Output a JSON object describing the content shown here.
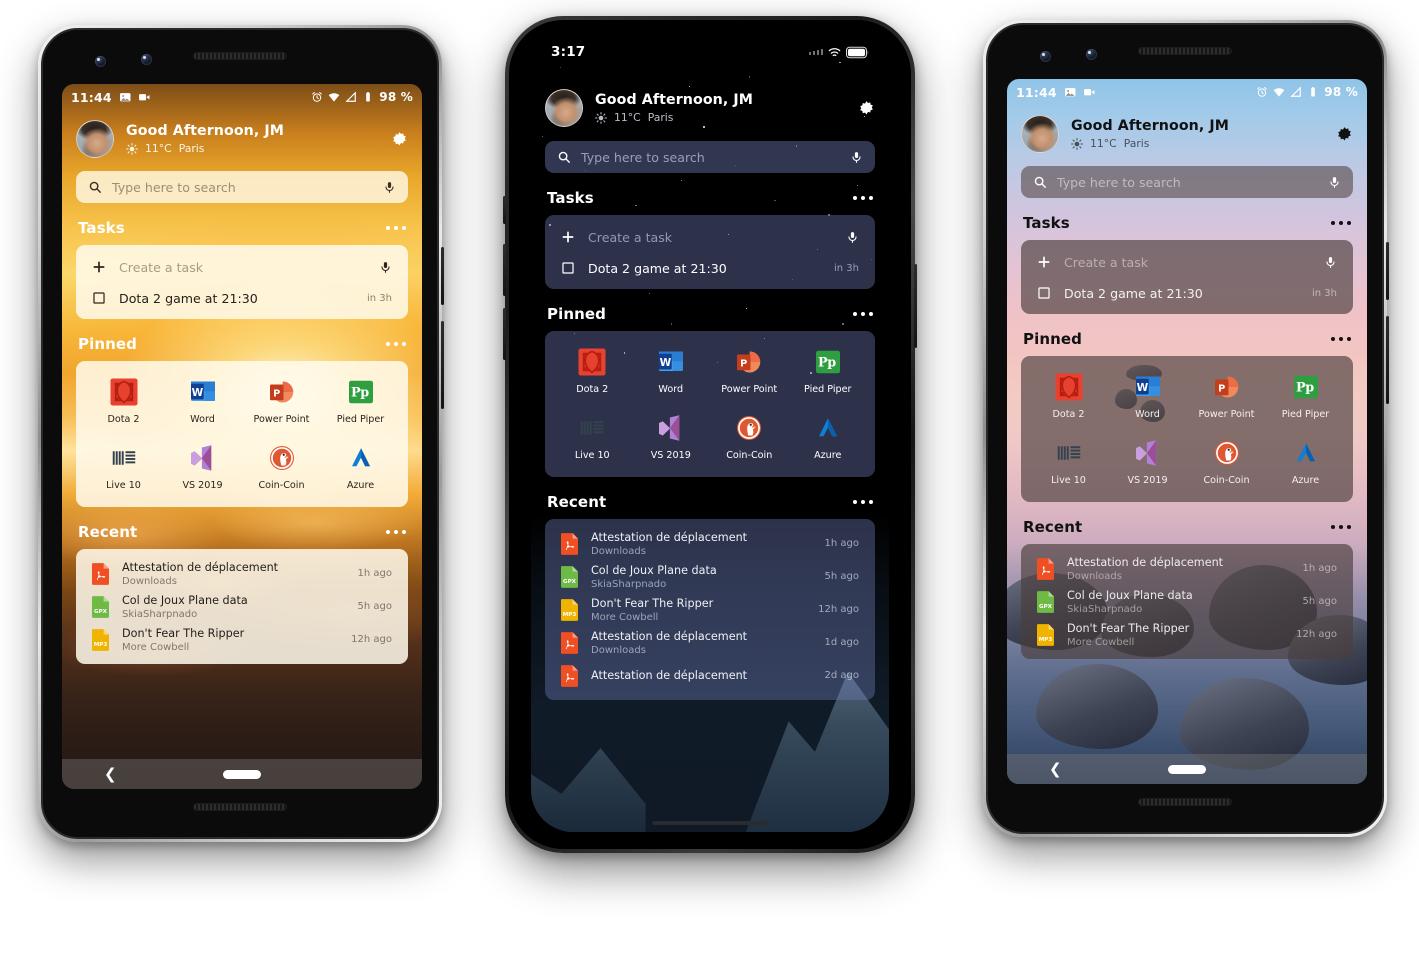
{
  "meta": {
    "accent_blue": "#2b579a",
    "accent_red": "#e8432e",
    "accent_green": "#2f9e41",
    "accent_orange": "#e8702a"
  },
  "phones": [
    {
      "id": "pixel-sunrise",
      "device": "pixel",
      "theme": "sunrise",
      "statusbar": {
        "time": "11:44",
        "left_icons": [
          "image-icon",
          "video-camera-icon"
        ],
        "right_icons": [
          "alarm-icon",
          "wifi-icon",
          "signal-icon",
          "battery-icon"
        ],
        "battery": "98 %"
      },
      "header": {
        "avatar": "user-avatar",
        "greeting": "Good Afternoon, JM",
        "weather_icon": "sun-icon",
        "temperature": "11°C",
        "city": "Paris",
        "settings_icon": "gear-icon"
      },
      "search": {
        "icon": "search-icon",
        "placeholder": "Type here to search",
        "mic_icon": "microphone-icon"
      },
      "sections": {
        "tasks": {
          "title": "Tasks",
          "overflow_icon": "more-icon"
        },
        "pinned": {
          "title": "Pinned",
          "overflow_icon": "more-icon"
        },
        "recent": {
          "title": "Recent",
          "overflow_icon": "more-icon"
        }
      },
      "tasks": {
        "create_placeholder": "Create a task",
        "add_icon": "plus-icon",
        "mic_icon": "microphone-icon",
        "items": [
          {
            "checkbox": "checkbox-unchecked",
            "label": "Dota 2 game at 21:30",
            "time": "in 3h"
          }
        ]
      },
      "pinned_apps": [
        {
          "name": "Dota 2",
          "icon": "dota2-icon"
        },
        {
          "name": "Word",
          "icon": "word-icon"
        },
        {
          "name": "Power Point",
          "icon": "powerpoint-icon"
        },
        {
          "name": "Pied Piper",
          "icon": "piedpiper-icon"
        },
        {
          "name": "Live 10",
          "icon": "ableton-icon"
        },
        {
          "name": "VS 2019",
          "icon": "visualstudio-icon"
        },
        {
          "name": "Coin-Coin",
          "icon": "duckduckgo-icon"
        },
        {
          "name": "Azure",
          "icon": "azure-icon"
        }
      ],
      "recent_files": [
        {
          "type": "PDF",
          "name": "Attestation de déplacement",
          "folder": "Downloads",
          "age": "1h ago"
        },
        {
          "type": "GPX",
          "name": "Col de Joux Plane data",
          "folder": "SkiaSharpnado",
          "age": "5h ago"
        },
        {
          "type": "MP3",
          "name": "Don't Fear The Ripper",
          "folder": "More Cowbell",
          "age": "12h ago"
        }
      ],
      "navbar": {
        "back_icon": "back-chevron-icon",
        "home_icon": "home-pill-icon"
      }
    },
    {
      "id": "iphone-night",
      "device": "iphone",
      "theme": "night",
      "statusbar": {
        "time": "3:17",
        "right_icons": [
          "cellular-dots-icon",
          "wifi-icon",
          "battery-icon"
        ]
      },
      "header": {
        "avatar": "user-avatar",
        "greeting": "Good Afternoon, JM",
        "weather_icon": "sun-icon",
        "temperature": "11°C",
        "city": "Paris",
        "settings_icon": "gear-icon"
      },
      "search": {
        "icon": "search-icon",
        "placeholder": "Type here to search",
        "mic_icon": "microphone-icon"
      },
      "sections": {
        "tasks": {
          "title": "Tasks",
          "overflow_icon": "more-icon"
        },
        "pinned": {
          "title": "Pinned",
          "overflow_icon": "more-icon"
        },
        "recent": {
          "title": "Recent",
          "overflow_icon": "more-icon"
        }
      },
      "tasks": {
        "create_placeholder": "Create a task",
        "add_icon": "plus-icon",
        "mic_icon": "microphone-icon",
        "items": [
          {
            "checkbox": "checkbox-unchecked",
            "label": "Dota 2 game at 21:30",
            "time": "in 3h"
          }
        ]
      },
      "pinned_apps": [
        {
          "name": "Dota 2",
          "icon": "dota2-icon"
        },
        {
          "name": "Word",
          "icon": "word-icon"
        },
        {
          "name": "Power Point",
          "icon": "powerpoint-icon"
        },
        {
          "name": "Pied Piper",
          "icon": "piedpiper-icon"
        },
        {
          "name": "Live 10",
          "icon": "ableton-icon"
        },
        {
          "name": "VS 2019",
          "icon": "visualstudio-icon"
        },
        {
          "name": "Coin-Coin",
          "icon": "duckduckgo-icon"
        },
        {
          "name": "Azure",
          "icon": "azure-icon"
        }
      ],
      "recent_files": [
        {
          "type": "PDF",
          "name": "Attestation de déplacement",
          "folder": "Downloads",
          "age": "1h ago"
        },
        {
          "type": "GPX",
          "name": "Col de Joux Plane data",
          "folder": "SkiaSharpnado",
          "age": "5h ago"
        },
        {
          "type": "MP3",
          "name": "Don't Fear The Ripper",
          "folder": "More Cowbell",
          "age": "12h ago"
        },
        {
          "type": "PDF",
          "name": "Attestation de déplacement",
          "folder": "Downloads",
          "age": "1d ago"
        },
        {
          "type": "PDF",
          "name": "Attestation de déplacement",
          "folder": "",
          "age": "2d ago"
        }
      ],
      "home_indicator": "home-indicator"
    },
    {
      "id": "pixel-pink",
      "device": "pixel",
      "theme": "pink",
      "statusbar": {
        "time": "11:44",
        "left_icons": [
          "image-icon",
          "video-camera-icon"
        ],
        "right_icons": [
          "alarm-icon",
          "wifi-icon",
          "signal-icon",
          "battery-icon"
        ],
        "battery": "98 %"
      },
      "header": {
        "avatar": "user-avatar",
        "greeting": "Good Afternoon, JM",
        "weather_icon": "sun-icon",
        "temperature": "11°C",
        "city": "Paris",
        "settings_icon": "gear-icon"
      },
      "search": {
        "icon": "search-icon",
        "placeholder": "Type here to search",
        "mic_icon": "microphone-icon"
      },
      "sections": {
        "tasks": {
          "title": "Tasks",
          "overflow_icon": "more-icon"
        },
        "pinned": {
          "title": "Pinned",
          "overflow_icon": "more-icon"
        },
        "recent": {
          "title": "Recent",
          "overflow_icon": "more-icon"
        }
      },
      "tasks": {
        "create_placeholder": "Create a task",
        "add_icon": "plus-icon",
        "mic_icon": "microphone-icon",
        "items": [
          {
            "checkbox": "checkbox-unchecked",
            "label": "Dota 2 game at 21:30",
            "time": "in 3h"
          }
        ]
      },
      "pinned_apps": [
        {
          "name": "Dota 2",
          "icon": "dota2-icon"
        },
        {
          "name": "Word",
          "icon": "word-icon"
        },
        {
          "name": "Power Point",
          "icon": "powerpoint-icon"
        },
        {
          "name": "Pied Piper",
          "icon": "piedpiper-icon"
        },
        {
          "name": "Live 10",
          "icon": "ableton-icon"
        },
        {
          "name": "VS 2019",
          "icon": "visualstudio-icon"
        },
        {
          "name": "Coin-Coin",
          "icon": "duckduckgo-icon"
        },
        {
          "name": "Azure",
          "icon": "azure-icon"
        }
      ],
      "recent_files": [
        {
          "type": "PDF",
          "name": "Attestation de déplacement",
          "folder": "Downloads",
          "age": "1h ago"
        },
        {
          "type": "GPX",
          "name": "Col de Joux Plane data",
          "folder": "SkiaSharpnado",
          "age": "5h ago"
        },
        {
          "type": "MP3",
          "name": "Don't Fear The Ripper",
          "folder": "More Cowbell",
          "age": "12h ago"
        }
      ],
      "navbar": {
        "back_icon": "back-chevron-icon",
        "home_icon": "home-pill-icon"
      }
    }
  ]
}
